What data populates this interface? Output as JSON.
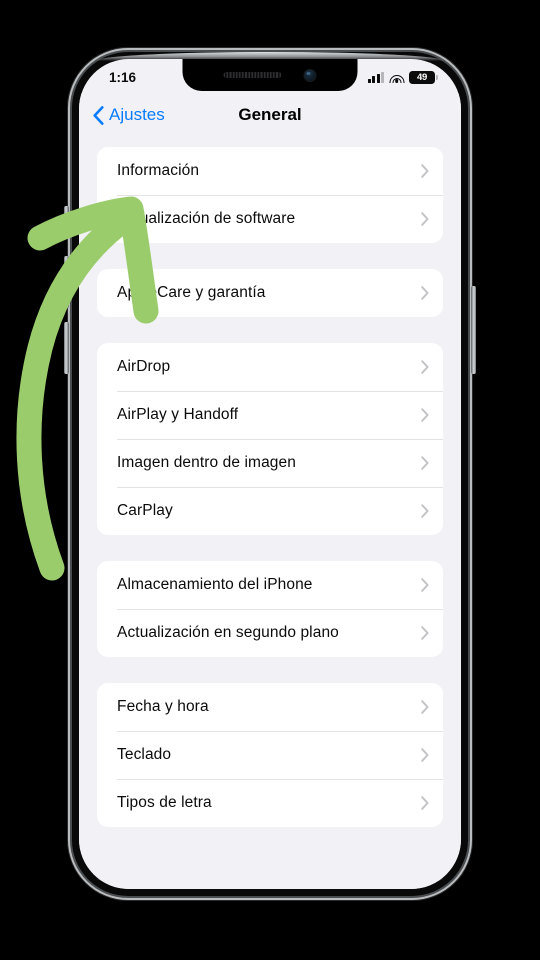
{
  "status_bar": {
    "time": "1:16",
    "signal_icon": "cellular-signal-icon",
    "wifi_icon": "wifi-icon",
    "battery_icon": "battery-icon",
    "battery_level": "49"
  },
  "nav_bar": {
    "back_label": "Ajustes",
    "back_icon": "chevron-left-icon",
    "title": "General"
  },
  "groups": [
    {
      "rows": [
        {
          "label": "Información",
          "chevron": "chevron-right-icon"
        },
        {
          "label": "Actualización de software",
          "chevron": "chevron-right-icon"
        }
      ]
    },
    {
      "rows": [
        {
          "label": "AppleCare y garantía",
          "chevron": "chevron-right-icon"
        }
      ]
    },
    {
      "rows": [
        {
          "label": "AirDrop",
          "chevron": "chevron-right-icon"
        },
        {
          "label": "AirPlay y Handoff",
          "chevron": "chevron-right-icon"
        },
        {
          "label": "Imagen dentro de imagen",
          "chevron": "chevron-right-icon"
        },
        {
          "label": "CarPlay",
          "chevron": "chevron-right-icon"
        }
      ]
    },
    {
      "rows": [
        {
          "label": "Almacenamiento del iPhone",
          "chevron": "chevron-right-icon"
        },
        {
          "label": "Actualización en segundo plano",
          "chevron": "chevron-right-icon"
        }
      ]
    },
    {
      "rows": [
        {
          "label": "Fecha y hora",
          "chevron": "chevron-right-icon"
        },
        {
          "label": "Teclado",
          "chevron": "chevron-right-icon"
        },
        {
          "label": "Tipos de letra",
          "chevron": "chevron-right-icon"
        }
      ]
    }
  ],
  "annotation": {
    "icon": "green-curved-arrow-annotation",
    "points_at": "Actualización de software"
  },
  "colors": {
    "accent_blue": "#0a7cff",
    "screen_background": "#f1f1f6",
    "card_background": "#ffffff",
    "separator": "#e4e4e6",
    "chevron_gray": "#c2c2c7",
    "annotation_green": "#9bcc6b",
    "page_background": "#000000"
  }
}
